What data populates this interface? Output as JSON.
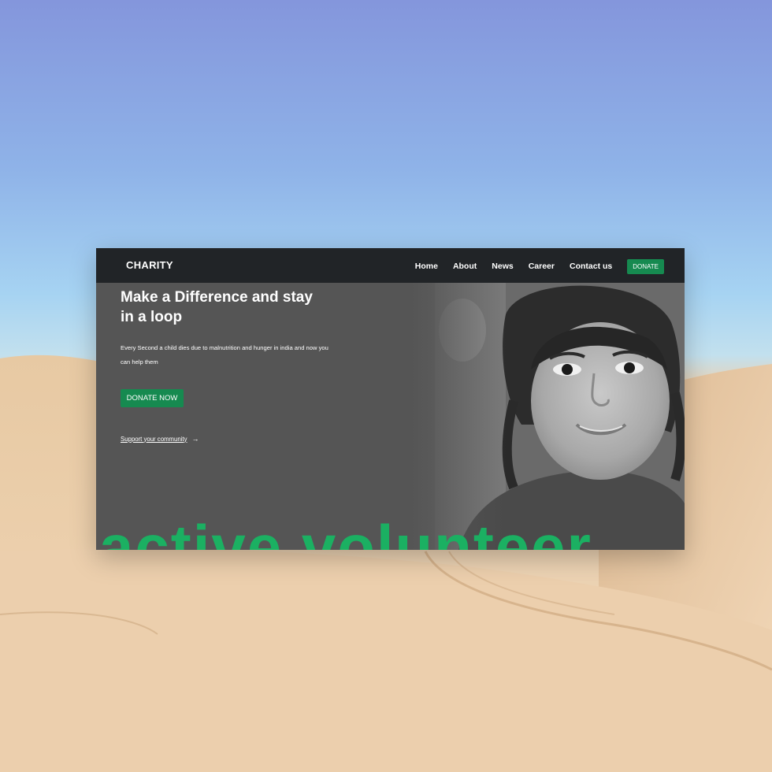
{
  "navbar": {
    "brand": "CHARITY",
    "links": [
      "Home",
      "About",
      "News",
      "Career",
      "Contact us"
    ],
    "donate_label": "DONATE"
  },
  "hero": {
    "title": "Make a Difference and stay in a loop",
    "description": "Every Second a child dies due to malnutrition and hunger in india and now you can help them",
    "cta_label": "DONATE NOW",
    "support_label": "Support your community",
    "watermark": "active volunteer"
  },
  "colors": {
    "accent": "#168a50",
    "navbar": "#212427",
    "hero_bg": "#555555",
    "watermark": "#1bb062"
  },
  "icons": {
    "support_arrow": "arrow-right-icon"
  }
}
